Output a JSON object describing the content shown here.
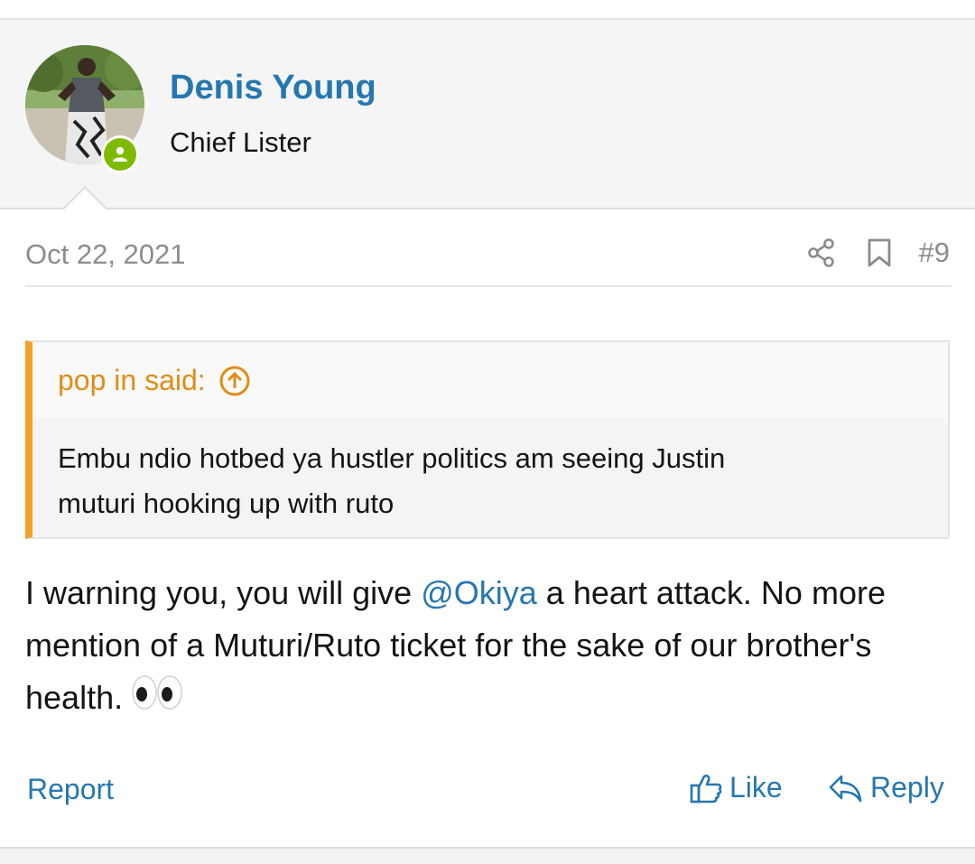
{
  "user": {
    "name": "Denis Young",
    "title": "Chief Lister",
    "online": true
  },
  "meta": {
    "date": "Oct 22, 2021",
    "post_number": "#9",
    "icons": [
      "share-icon",
      "bookmark-icon"
    ]
  },
  "quote": {
    "author_label": "pop in said:",
    "icon": "arrow-up-circle-icon",
    "text_line1": "Embu ndio hotbed ya hustler politics am seeing Justin",
    "text_line2": "muturi hooking up with ruto"
  },
  "message": {
    "part1": "I warning you, you will give ",
    "mention": "@Okiya",
    "part2": " a heart attack. No more mention of a Muturi/Ruto ticket for the sake of our brother's health.",
    "emoji": "eyes-emoji"
  },
  "actions": {
    "report_label": "Report",
    "like_label": "Like",
    "reply_label": "Reply"
  },
  "colors": {
    "link": "#2577b1",
    "quote_accent": "#f3a122",
    "quote_author": "#e08d15",
    "online": "#7fba00",
    "muted": "#8c8c8c"
  }
}
